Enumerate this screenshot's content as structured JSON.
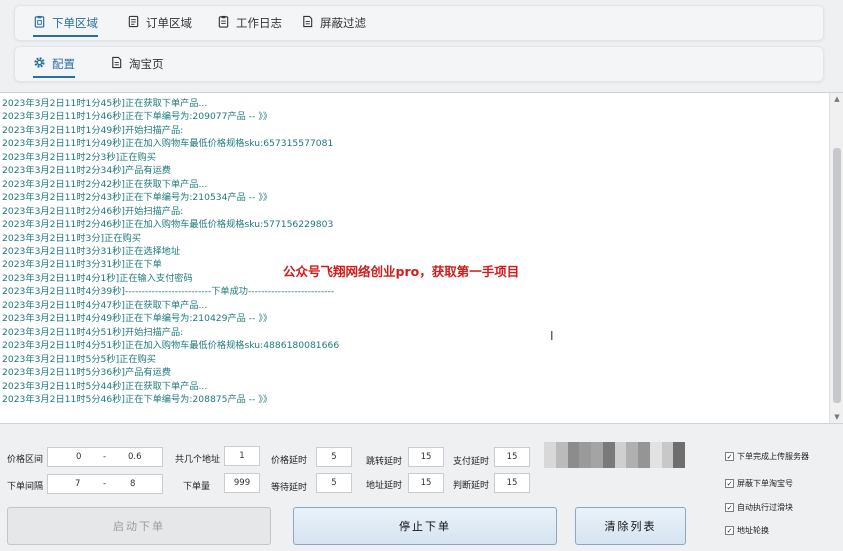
{
  "top_tabs": [
    {
      "label": "下单区域",
      "icon": "clipboard-icon",
      "active": true
    },
    {
      "label": "订单区域",
      "icon": "document-icon",
      "active": false
    },
    {
      "label": "工作日志",
      "icon": "clipboard-list-icon",
      "active": false
    },
    {
      "label": "屏蔽过滤",
      "icon": "document-icon",
      "active": false
    }
  ],
  "sub_tabs": [
    {
      "label": "配置",
      "icon": "gear-icon",
      "active": true
    },
    {
      "label": "淘宝页",
      "icon": "document-icon",
      "active": false
    }
  ],
  "log_lines": [
    "2023年3月2日11时1分45秒]正在获取下单产品...",
    "2023年3月2日11时1分46秒]正在下单编号为:209077产品 -- 》》",
    "2023年3月2日11时1分49秒]开始扫描产品:",
    "2023年3月2日11时1分49秒]正在加入购物车最低价格规格sku:657315577081",
    "2023年3月2日11时2分3秒]正在购买",
    "2023年3月2日11时2分34秒]产品有运费",
    "2023年3月2日11时2分42秒]正在获取下单产品...",
    "2023年3月2日11时2分43秒]正在下单编号为:210534产品 -- 》》",
    "2023年3月2日11时2分46秒]开始扫描产品:",
    "2023年3月2日11时2分46秒]正在加入购物车最低价格规格sku:577156229803",
    "2023年3月2日11时3分]正在购买",
    "2023年3月2日11时3分31秒]正在选择地址",
    "2023年3月2日11时3分31秒]正在下单",
    "2023年3月2日11时4分1秒]正在输入支付密码",
    "2023年3月2日11时4分39秒]--------------------------下单成功--------------------------",
    "2023年3月2日11时4分47秒]正在获取下单产品...",
    "2023年3月2日11时4分49秒]正在下单编号为:210429产品 -- 》》",
    "2023年3月2日11时4分51秒]开始扫描产品:",
    "2023年3月2日11时4分51秒]正在加入购物车最低价格规格sku:4886180081666",
    "2023年3月2日11时5分5秒]正在购买",
    "2023年3月2日11时5分36秒]产品有运费",
    "2023年3月2日11时5分44秒]正在获取下单产品...",
    "2023年3月2日11时5分46秒]正在下单编号为:208875产品 -- 》》"
  ],
  "watermark": "公众号飞翔网络创业pro，获取第一手项目",
  "settings": {
    "price_range_label": "价格区间",
    "price_min": "0",
    "price_max": "0.6",
    "order_interval_label": "下单间隔",
    "interval_min": "7",
    "interval_max": "8",
    "range_sep": "-",
    "addr_count_label": "共几个地址",
    "addr_count": "1",
    "order_qty_label": "下单量",
    "order_qty": "999",
    "price_delay_label": "价格延时",
    "price_delay": "5",
    "wait_delay_label": "等待延时",
    "wait_delay": "5",
    "jump_delay_label": "跳转延时",
    "jump_delay": "15",
    "addr_delay_label": "地址延时",
    "addr_delay": "15",
    "pay_delay_label": "支付延时",
    "pay_delay": "15",
    "judge_delay_label": "判断延时",
    "judge_delay": "15"
  },
  "buttons": {
    "start": "启动下单",
    "stop": "停止下单",
    "clear": "清除列表"
  },
  "checkboxes": [
    {
      "label": "下单完成上传服务器",
      "checked": true
    },
    {
      "label": "屏蔽下单淘宝号",
      "checked": true
    },
    {
      "label": "自动执行过滑块",
      "checked": true
    },
    {
      "label": "地址轮换",
      "checked": true
    }
  ]
}
